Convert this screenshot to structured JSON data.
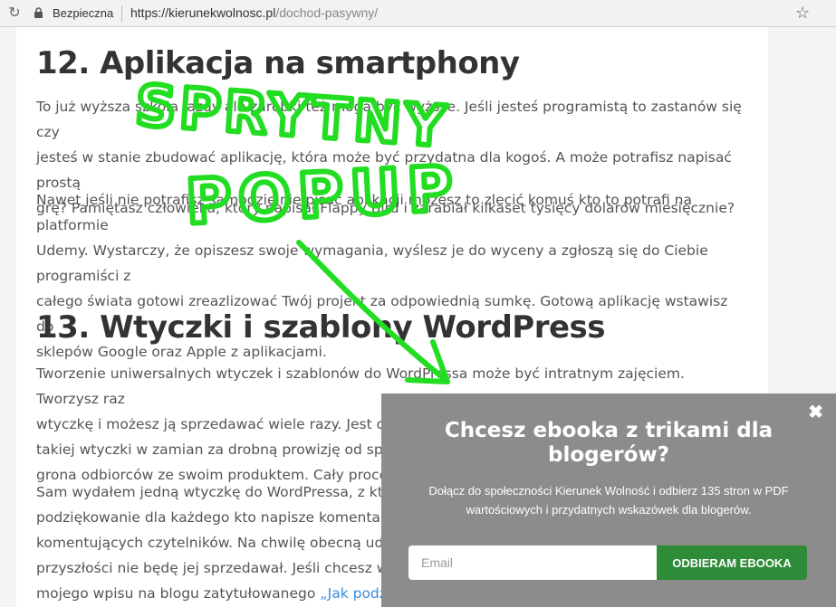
{
  "browser": {
    "secure_label": "Bezpieczna",
    "url_base": "https://kierunekwolnosc.pl",
    "url_path": "/dochod-pasywny/"
  },
  "article": {
    "section12": {
      "heading": "12. Aplikacja na smartphony",
      "p1": [
        "To już wyższa szkoła jazdy ale zarobki też mogą być wyższe. Jeśli jesteś programistą to zastanów się czy",
        "jesteś w stanie zbudować aplikację, która może być przydatna dla kogoś. A może potrafisz napisać prostą",
        "grę? Pamiętasz człowieka, który napisał Flappy Bird i zarabiał kilkaset tysięcy dolarów miesięcznie?"
      ],
      "p2": [
        "Nawet jeśli nie potrafisz samodzielnie pisać aplikacji możesz to zlecić komuś kto to potrafi na platformie",
        "Udemy. Wystarczy, że opiszesz swoje wymagania, wyślesz je do wyceny a zgłoszą się do Ciebie programiści z",
        "całego świata gotowi zreazlizować Twój projekt za odpowiednią sumkę. Gotową aplikację wstawisz do",
        "sklepów Google oraz Apple z aplikacjami."
      ]
    },
    "section13": {
      "heading": "13. Wtyczki i szablony WordPress",
      "p1": [
        "Tworzenie uniwersalnych wtyczek i szablonów do WordPressa może być intratnym zajęciem. Tworzysz raz",
        "wtyczkę i możesz ją sprzedawać wiele razy. Jest dużo",
        "takiej wtyczki w zamian za drobną prowizję od sprzed",
        "grona odbiorców ze swoim produktem. Cały proces s"
      ],
      "p2": [
        "Sam wydałem jedną wtyczkę do WordPressa, z której",
        "podziękowanie dla każdego kto napisze komentarz n",
        "komentujących czytelników. Na chwilę obecną udost",
        "przyszłości nie będę jej sprzedawał. Jeśli chcesz wypr"
      ],
      "p2_last_prefix": "mojego wpisu na blogu zatytułowanego ",
      "p2_last_link": "„Jak podzięk"
    }
  },
  "annotation": {
    "line1": "SPRYTNY",
    "line2": "POPUP",
    "color": "#22dd22"
  },
  "popup": {
    "close_symbol": "✖",
    "title": "Chcesz ebooka z trikami dla blogerów?",
    "description": "Dołącz do społeczności Kierunek Wolność i odbierz 135 stron w PDF wartościowych i przydatnych wskazówek dla blogerów.",
    "email_placeholder": "Email",
    "button_label": "ODBIERAM EBOOKA",
    "bg_color": "#8c8c8c",
    "button_color": "#2e8b37"
  }
}
